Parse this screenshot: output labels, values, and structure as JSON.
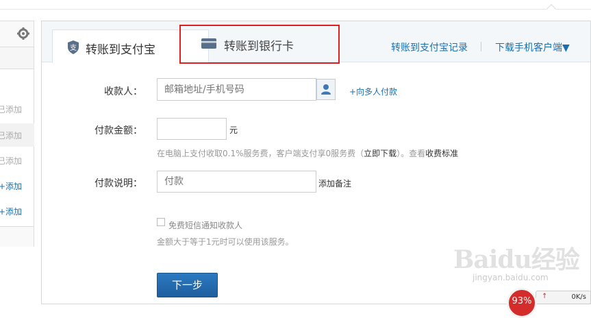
{
  "sidebar": {
    "items": [
      {
        "label": "已添加",
        "state": "added"
      },
      {
        "label": "已添加",
        "state": "added"
      },
      {
        "label": "已添加",
        "state": "added"
      },
      {
        "label": "+添加",
        "state": "add"
      },
      {
        "label": "+添加",
        "state": "add"
      }
    ]
  },
  "tabs": {
    "alipay": "转账到支付宝",
    "bank": "转账到银行卡"
  },
  "header_links": {
    "records": "转账到支付宝记录",
    "download": "下载手机客户端▼"
  },
  "form": {
    "payee_label": "收款人：",
    "payee_placeholder": "邮箱地址/手机号码",
    "multi_pay": "+向多人付款",
    "amount_label": "付款金额：",
    "amount_value": "",
    "currency": "元",
    "fee_tip_prefix": "在电脑上支付收取0.1%服务费，客户端支付享0服务费（",
    "fee_tip_link": "立即下载",
    "fee_tip_mid": "）。查看",
    "fee_tip_std": "收费标准",
    "note_label": "付款说明：",
    "note_placeholder": "付款",
    "add_note": "添加备注",
    "sms_label": "免费短信通知收款人",
    "sms_tip": "金额大于等于1元时可以使用该服务。",
    "next_button": "下一步"
  },
  "watermark": {
    "main": "Baidu经验",
    "sub": "jingyan.baidu.com"
  },
  "speed_widget": {
    "percent": "93%",
    "rate": "0K/s"
  },
  "colors": {
    "link_blue": "#1a6fb0",
    "button_blue": "#2c79c0",
    "highlight_red": "#e02020"
  }
}
